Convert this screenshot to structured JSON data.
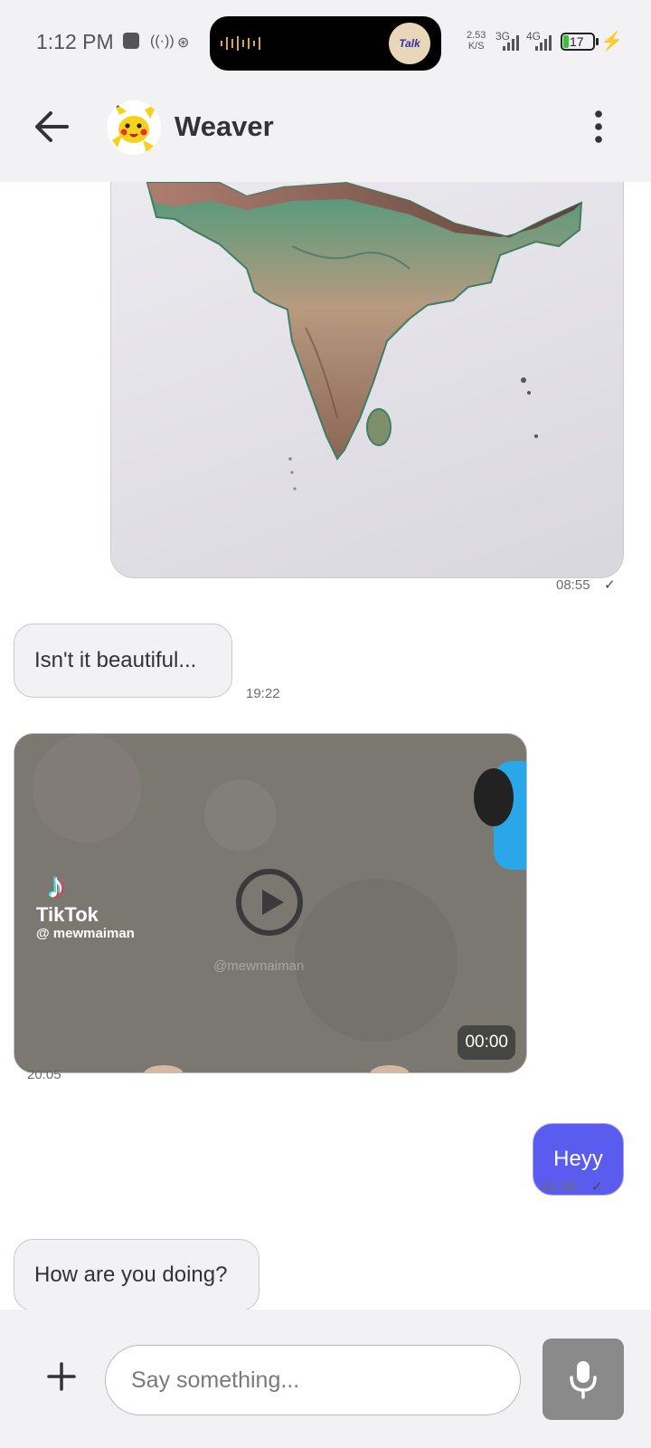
{
  "status_bar": {
    "time": "1:12 PM",
    "net_speed_value": "2.53",
    "net_speed_unit": "K/S",
    "signal_1": "3G",
    "signal_2": "4G",
    "battery_level": "17",
    "island_avatar_text": "Talk",
    "icons": [
      "square-icon",
      "radio-icon",
      "bug-icon",
      "waveform-icon",
      "signal-icon",
      "battery-icon",
      "charging-bolt-icon"
    ]
  },
  "header": {
    "contact_name": "Weaver",
    "icons": [
      "back-arrow-icon",
      "pikachu-avatar",
      "more-vert-icon"
    ]
  },
  "messages": {
    "map_time": "08:55",
    "msg1_text": "Isn't it beautiful...",
    "msg1_time": "19:22",
    "video_duration": "00:00",
    "video_brand": "TikTok",
    "video_handle": "@ mewmaiman",
    "video_watermark": "@mewmaiman",
    "video_time": "20:05",
    "msg2_text": "Heyy",
    "msg2_time": "01:45",
    "msg3_text": "How are you doing?"
  },
  "composer": {
    "placeholder": "Say something...",
    "icons": [
      "plus-icon",
      "mic-icon"
    ]
  },
  "colors": {
    "accent": "#5a5cf0",
    "bar_bg": "#f2f2f4",
    "charging": "#3ac23a"
  }
}
